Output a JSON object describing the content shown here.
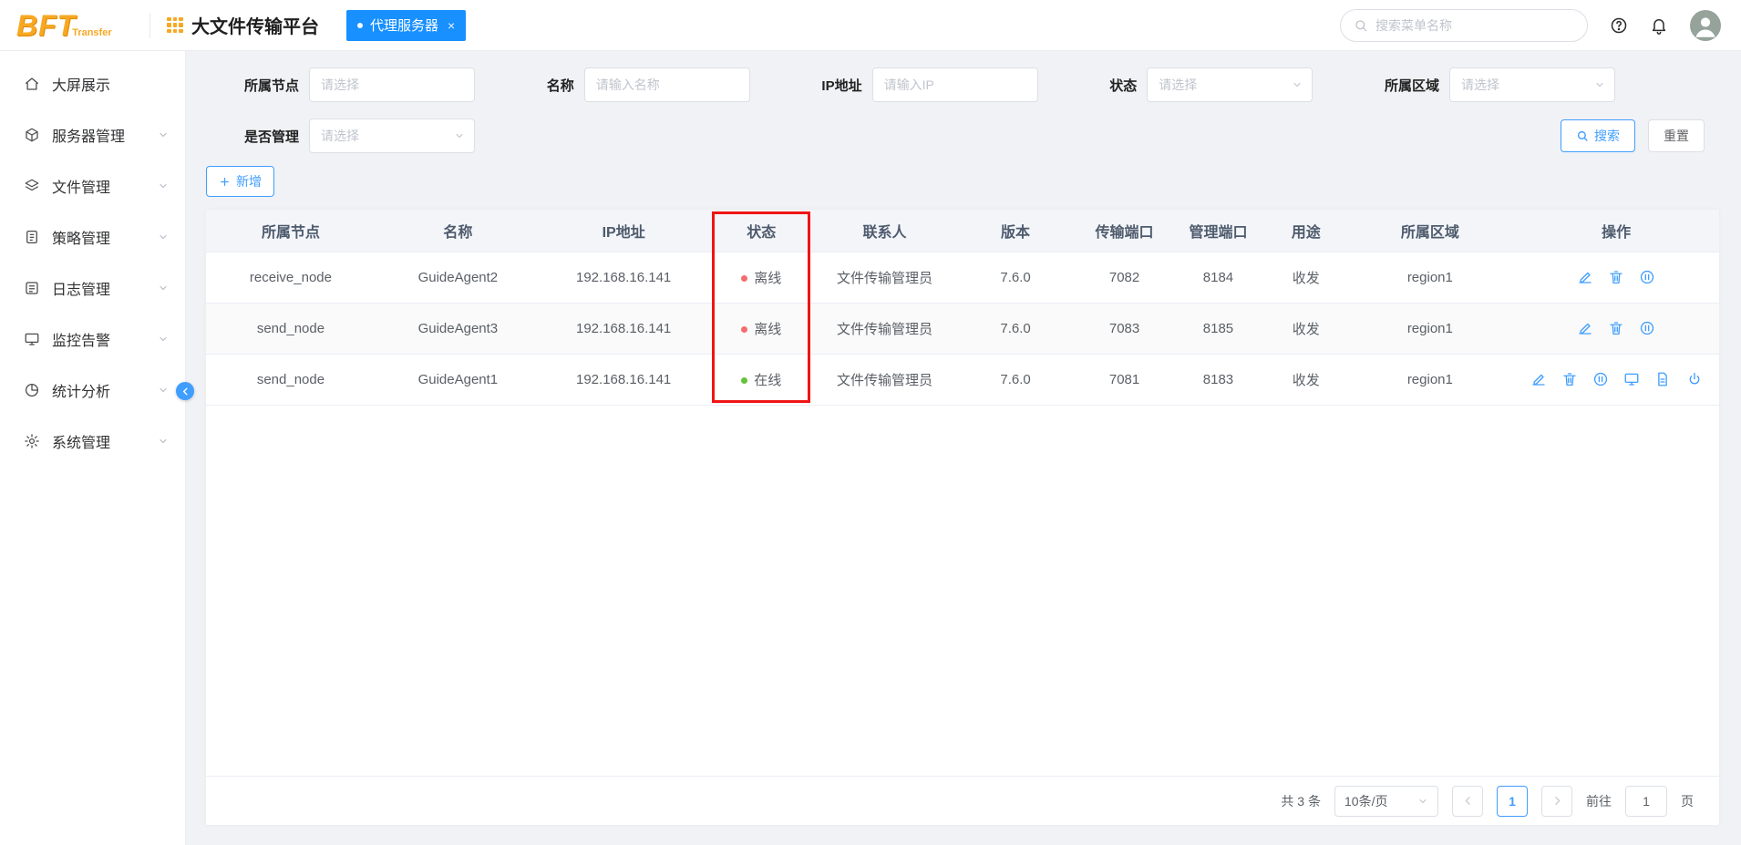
{
  "colors": {
    "primary": "#409eff",
    "tab_blue": "#1890ff",
    "logo_orange": "#f7a823",
    "status_offline": "#f56c6c",
    "status_online": "#67c23a",
    "annotation_red": "#f01414"
  },
  "header": {
    "logo_main": "BFT",
    "logo_sub": "Transfer",
    "app_title": "大文件传输平台",
    "tab": {
      "label": "代理服务器",
      "close_label": "×"
    },
    "search_placeholder": "搜索菜单名称"
  },
  "sidebar": {
    "items": [
      {
        "label": "大屏展示",
        "icon": "home-icon",
        "has_children": false
      },
      {
        "label": "服务器管理",
        "icon": "server-icon",
        "has_children": true
      },
      {
        "label": "文件管理",
        "icon": "files-icon",
        "has_children": true
      },
      {
        "label": "策略管理",
        "icon": "strategy-icon",
        "has_children": true
      },
      {
        "label": "日志管理",
        "icon": "log-icon",
        "has_children": true
      },
      {
        "label": "监控告警",
        "icon": "monitor-icon",
        "has_children": true
      },
      {
        "label": "统计分析",
        "icon": "stats-icon",
        "has_children": true
      },
      {
        "label": "系统管理",
        "icon": "settings-icon",
        "has_children": true
      }
    ]
  },
  "filters": {
    "node_label": "所属节点",
    "node_placeholder": "请选择",
    "name_label": "名称",
    "name_placeholder": "请输入名称",
    "ip_label": "IP地址",
    "ip_placeholder": "请输入IP",
    "status_label": "状态",
    "status_placeholder": "请选择",
    "region_label": "所属区域",
    "region_placeholder": "请选择",
    "managed_label": "是否管理",
    "managed_placeholder": "请选择",
    "search_button": "搜索",
    "reset_button": "重置"
  },
  "toolbar": {
    "add_button": "新增"
  },
  "table": {
    "columns": [
      "所属节点",
      "名称",
      "IP地址",
      "状态",
      "联系人",
      "版本",
      "传输端口",
      "管理端口",
      "用途",
      "所属区域",
      "操作"
    ],
    "rows": [
      {
        "node": "receive_node",
        "name": "GuideAgent2",
        "ip": "192.168.16.141",
        "status": "离线",
        "status_state": "offline",
        "contact": "文件传输管理员",
        "version": "7.6.0",
        "transfer_port": "7082",
        "manage_port": "8184",
        "usage": "收发",
        "region": "region1",
        "actions": [
          "edit",
          "delete",
          "pause"
        ]
      },
      {
        "node": "send_node",
        "name": "GuideAgent3",
        "ip": "192.168.16.141",
        "status": "离线",
        "status_state": "offline",
        "contact": "文件传输管理员",
        "version": "7.6.0",
        "transfer_port": "7083",
        "manage_port": "8185",
        "usage": "收发",
        "region": "region1",
        "actions": [
          "edit",
          "delete",
          "pause"
        ]
      },
      {
        "node": "send_node",
        "name": "GuideAgent1",
        "ip": "192.168.16.141",
        "status": "在线",
        "status_state": "online",
        "contact": "文件传输管理员",
        "version": "7.6.0",
        "transfer_port": "7081",
        "manage_port": "8183",
        "usage": "收发",
        "region": "region1",
        "actions": [
          "edit",
          "delete",
          "pause",
          "monitor",
          "doc",
          "power"
        ]
      }
    ]
  },
  "pagination": {
    "total": "共 3 条",
    "page_size": "10条/页",
    "page": "1",
    "goto_label": "前往",
    "goto_value": "1",
    "goto_suffix": "页"
  },
  "annotation": {
    "shape": "red-box",
    "target": "status-column"
  }
}
